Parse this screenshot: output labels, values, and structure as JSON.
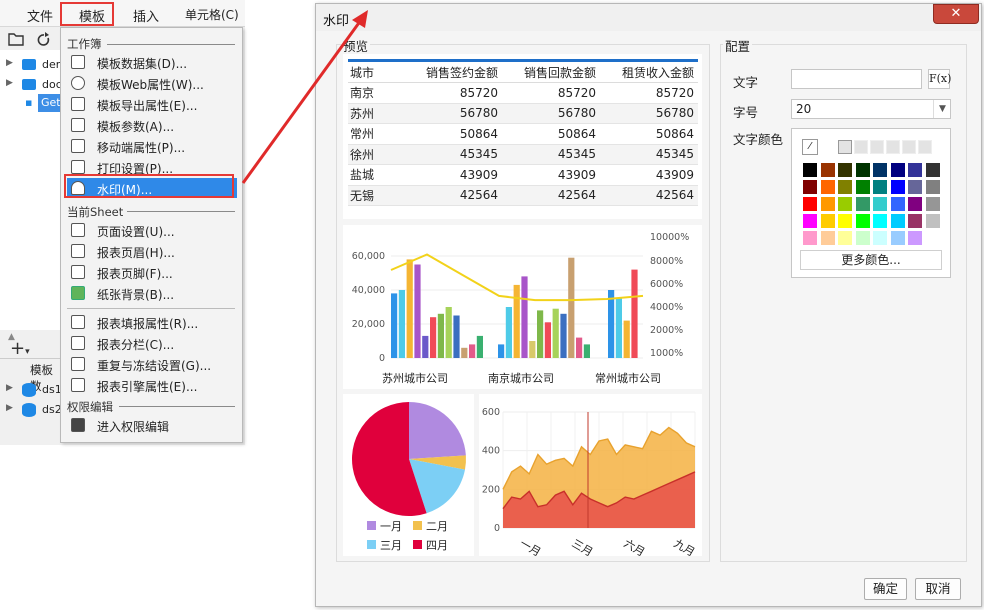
{
  "menubar": {
    "file": "文件",
    "template": "模板",
    "insert": "插入",
    "cell": "单元格(C)"
  },
  "tree": {
    "items": [
      {
        "label": "dem"
      },
      {
        "label": "doc"
      },
      {
        "label": "Get"
      }
    ],
    "datasets": [
      {
        "label": "ds1"
      },
      {
        "label": "ds2"
      }
    ],
    "panel_label": "模板数"
  },
  "dropdown": {
    "section_workbook": "工作簿",
    "section_sheet": "当前Sheet",
    "section_permission": "权限编辑",
    "items_workbook": [
      {
        "label": "模板数据集(D)...",
        "icon": "database-icon"
      },
      {
        "label": "模板Web属性(W)...",
        "icon": "globe-icon"
      },
      {
        "label": "模板导出属性(E)...",
        "icon": "export-icon"
      },
      {
        "label": "模板参数(A)...",
        "icon": "parameter-icon"
      },
      {
        "label": "移动端属性(P)...",
        "icon": "mobile-icon"
      },
      {
        "label": "打印设置(P)...",
        "icon": "printer-icon"
      },
      {
        "label": "水印(M)...",
        "icon": "watermark-stamp-icon"
      }
    ],
    "items_sheet": [
      {
        "label": "页面设置(U)...",
        "icon": "page-setup-icon"
      },
      {
        "label": "报表页眉(H)...",
        "icon": "header-icon"
      },
      {
        "label": "报表页脚(F)...",
        "icon": "footer-icon"
      },
      {
        "label": "纸张背景(B)...",
        "icon": "background-image-icon"
      }
    ],
    "items_sheet2": [
      {
        "label": "报表填报属性(R)...",
        "icon": "fill-report-icon"
      },
      {
        "label": "报表分栏(C)...",
        "icon": "columns-icon"
      },
      {
        "label": "重复与冻结设置(G)...",
        "icon": "freeze-icon"
      },
      {
        "label": "报表引擎属性(E)...",
        "icon": "engine-icon"
      }
    ],
    "items_permission": [
      {
        "label": "进入权限编辑",
        "icon": "permission-grid-icon"
      }
    ]
  },
  "dialog": {
    "title": "水印",
    "close": "✕",
    "preview_label": "预览",
    "config_label": "配置",
    "text_label": "文字",
    "text_value": "",
    "fx_label": "F(x)",
    "size_label": "字号",
    "size_value": "20",
    "color_label": "文字颜色",
    "more_colors": "更多颜色...",
    "ok": "确定",
    "cancel": "取消",
    "colors": {
      "row1": [
        "#000000",
        "#993300",
        "#333300",
        "#003300",
        "#003366",
        "#000080",
        "#333399",
        "#333333"
      ],
      "row2": [
        "#800000",
        "#ff6600",
        "#808000",
        "#008000",
        "#008080",
        "#0000ff",
        "#666699",
        "#808080"
      ],
      "row3": [
        "#ff0000",
        "#ff9900",
        "#99cc00",
        "#339966",
        "#33cccc",
        "#3366ff",
        "#800080",
        "#969696"
      ],
      "row4": [
        "#ff00ff",
        "#ffcc00",
        "#ffff00",
        "#00ff00",
        "#00ffff",
        "#00ccff",
        "#993366",
        "#c0c0c0"
      ],
      "row5": [
        "#ff99cc",
        "#ffcc99",
        "#ffff99",
        "#ccffcc",
        "#ccffff",
        "#99ccff",
        "#cc99ff",
        "#ffffff"
      ]
    }
  },
  "table": {
    "headers": [
      "城市",
      "销售签约金额",
      "销售回款金额",
      "租赁收入金额"
    ],
    "rows": [
      [
        "南京",
        "85720",
        "85720",
        "85720"
      ],
      [
        "苏州",
        "56780",
        "56780",
        "56780"
      ],
      [
        "常州",
        "50864",
        "50864",
        "50864"
      ],
      [
        "徐州",
        "45345",
        "45345",
        "45345"
      ],
      [
        "盐城",
        "43909",
        "43909",
        "43909"
      ],
      [
        "无锡",
        "42564",
        "42564",
        "42564"
      ]
    ]
  },
  "chart_data": [
    {
      "type": "bar",
      "categories": [
        "苏州城市公司",
        "南京城市公司",
        "常州城市公司"
      ],
      "ylim": [
        0,
        70000
      ],
      "y_ticks": [
        "0",
        "20,000",
        "40,000",
        "60,000"
      ],
      "y2_ticks": [
        "1000%",
        "2000%",
        "4000%",
        "6000%",
        "8000%",
        "10000%"
      ],
      "groups": [
        {
          "values": [
            38000,
            40000,
            58000,
            55000,
            13000,
            24000,
            26000,
            30000,
            25000,
            6000,
            8000,
            13000
          ],
          "colors": [
            "#2d93e8",
            "#4ecbe8",
            "#f5b533",
            "#a855c9",
            "#6b59c9",
            "#f04a57",
            "#7fb84a",
            "#a7d35a",
            "#3b6fc0",
            "#c8a070",
            "#e25a8a",
            "#3ab070"
          ]
        },
        {
          "values": [
            8000,
            30000,
            43000,
            48000,
            10000,
            28000,
            21000,
            29000,
            26000,
            59000,
            12000,
            8000
          ],
          "colors": [
            "#2d93e8",
            "#4ecbe8",
            "#f5b533",
            "#a855c9",
            "#d8c96a",
            "#7fb84a",
            "#f04a57",
            "#a7d35a",
            "#3b6fc0",
            "#c8a070",
            "#e25a8a",
            "#3ab070"
          ]
        },
        {
          "values": [
            40000,
            35000,
            22000,
            52000
          ],
          "colors": [
            "#2d93e8",
            "#4ecbe8",
            "#f5b533",
            "#f04a57"
          ]
        }
      ],
      "line": {
        "color": "#f2d21a",
        "values": [
          8500,
          10000,
          8000,
          6000,
          5600,
          5600,
          5700,
          6000
        ]
      }
    },
    {
      "type": "pie",
      "legend": [
        "一月",
        "二月",
        "三月",
        "四月"
      ],
      "values": [
        24,
        4,
        17,
        55
      ],
      "colors": [
        "#b08ae0",
        "#f2c14e",
        "#7ccff5",
        "#e0003c"
      ]
    },
    {
      "type": "area",
      "x_labels": [
        "一月",
        "三月",
        "六月",
        "九月"
      ],
      "y_ticks": [
        "0",
        "200",
        "400",
        "600"
      ],
      "ylim": [
        0,
        600
      ],
      "series": [
        {
          "values": [
            200,
            290,
            320,
            280,
            380,
            330,
            350,
            360,
            320,
            420,
            380,
            450,
            460,
            380,
            430,
            420,
            410,
            500,
            480,
            520,
            490,
            440,
            420
          ],
          "color": "#f5b242"
        },
        {
          "values": [
            100,
            160,
            150,
            190,
            110,
            120,
            170,
            190,
            120,
            180,
            150,
            130,
            110,
            130,
            160,
            150,
            170,
            190,
            210,
            230,
            250,
            270,
            290
          ],
          "color": "#e9554b"
        }
      ]
    }
  ]
}
